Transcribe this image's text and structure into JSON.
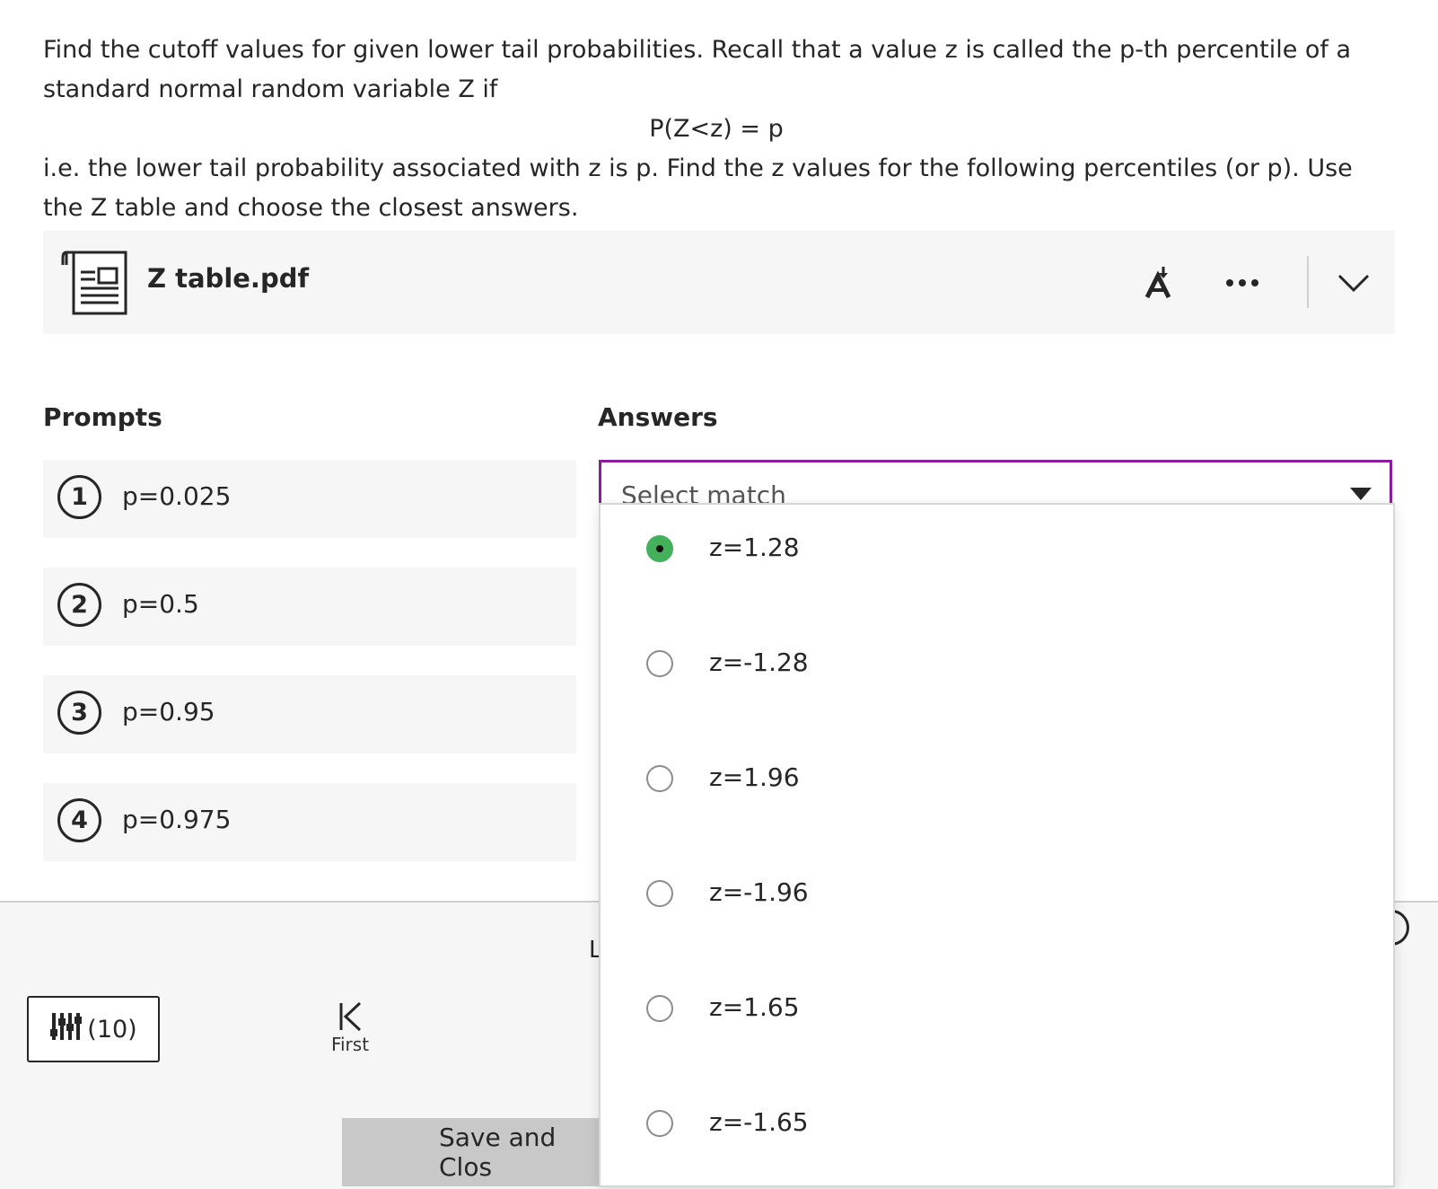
{
  "question": {
    "line1": "Find the cutoff values for given lower tail probabilities. Recall that a value z is called the p-th percentile of a standard normal random variable Z if",
    "formula": "P(Z<z) = p",
    "line2": "i.e. the lower tail probability associated with z is p. Find the z values for the following percentiles (or p). Use the Z table and choose the closest answers."
  },
  "attachment": {
    "file_name": "Z table.pdf",
    "icons": [
      "document-icon",
      "accessibility-download-icon",
      "more-options-icon",
      "chevron-down-icon"
    ]
  },
  "matching": {
    "prompts_heading": "Prompts",
    "answers_heading": "Answers",
    "prompts": [
      {
        "number": "1",
        "text": "p=0.025"
      },
      {
        "number": "2",
        "text": "p=0.5"
      },
      {
        "number": "3",
        "text": "p=0.95"
      },
      {
        "number": "4",
        "text": "p=0.975"
      }
    ],
    "select_placeholder": "Select match",
    "options": [
      {
        "label": "z=1.28",
        "selected": true
      },
      {
        "label": "z=-1.28",
        "selected": false
      },
      {
        "label": "z=1.96",
        "selected": false
      },
      {
        "label": "z=-1.96",
        "selected": false
      },
      {
        "label": "z=1.65",
        "selected": false
      },
      {
        "label": "z=-1.65",
        "selected": false
      }
    ]
  },
  "footer": {
    "filter_count": "(10)",
    "first_label": "First",
    "save_label": "Save and Clos",
    "peek_letter": "L"
  },
  "colors": {
    "select_border": "#8b1e9e",
    "radio_selected": "#43b05c",
    "panel_bg": "#f6f6f6"
  }
}
